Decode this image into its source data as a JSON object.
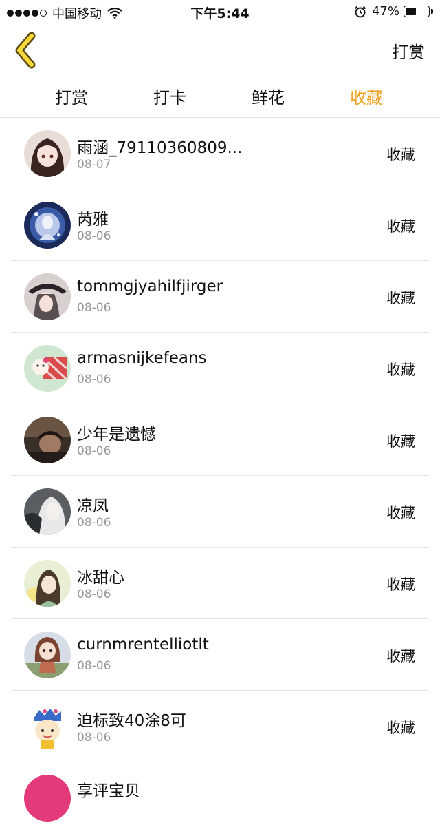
{
  "status_bar": {
    "carrier": "中国移动",
    "time": "下午5:44",
    "battery_text": "47%",
    "battery_level": 0.47
  },
  "nav": {
    "back_icon": "chevron-left-icon",
    "action_label": "打赏",
    "accent_color": "#f0a020"
  },
  "tabs": [
    {
      "label": "打赏",
      "active": false
    },
    {
      "label": "打卡",
      "active": false
    },
    {
      "label": "鲜花",
      "active": false
    },
    {
      "label": "收藏",
      "active": true
    }
  ],
  "items": [
    {
      "name": "雨涵_79110360809...",
      "date": "08-07",
      "action": "收藏"
    },
    {
      "name": "芮雅",
      "date": "08-06",
      "action": "收藏"
    },
    {
      "name": "tommgjyahilfjirger",
      "date": "08-06",
      "action": "收藏"
    },
    {
      "name": "armasnijkefeans",
      "date": "08-06",
      "action": "收藏"
    },
    {
      "name": "少年是遗憾",
      "date": "08-06",
      "action": "收藏"
    },
    {
      "name": "凉凤",
      "date": "08-06",
      "action": "收藏"
    },
    {
      "name": "冰甜心",
      "date": "08-06",
      "action": "收藏"
    },
    {
      "name": "curnmrentelliotlt",
      "date": "08-06",
      "action": "收藏"
    },
    {
      "name": "迫标致40涂8可",
      "date": "08-06",
      "action": "收藏"
    }
  ],
  "partial_item": {
    "name": "享评宝贝"
  }
}
